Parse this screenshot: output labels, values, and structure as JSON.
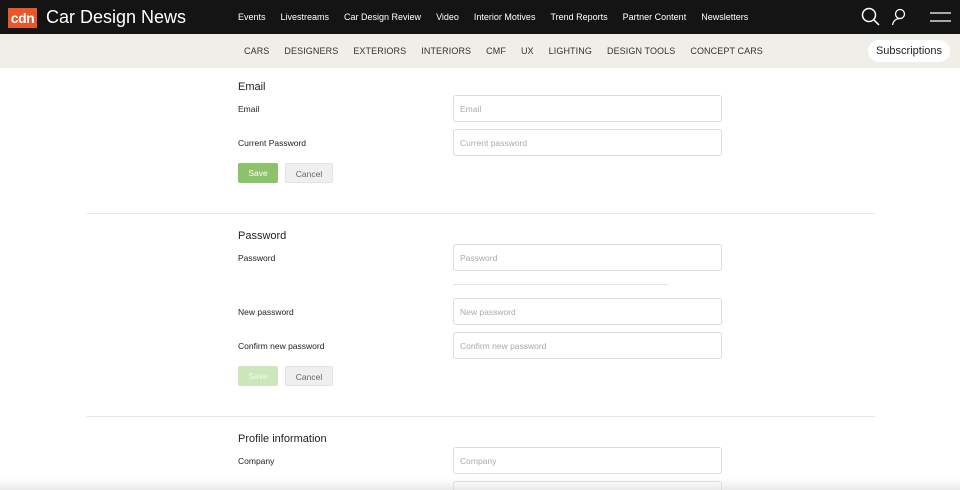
{
  "header": {
    "logo_text": "cdn",
    "brand": "Car Design News",
    "nav": [
      "Events",
      "Livestreams",
      "Car Design Review",
      "Video",
      "Interior Motives",
      "Trend Reports",
      "Partner Content",
      "Newsletters"
    ],
    "icons": [
      "search-icon",
      "user-icon",
      "menu-icon"
    ]
  },
  "subnav": {
    "items": [
      "CARS",
      "DESIGNERS",
      "EXTERIORS",
      "INTERIORS",
      "CMF",
      "UX",
      "LIGHTING",
      "DESIGN TOOLS",
      "CONCEPT CARS"
    ],
    "subscriptions_label": "Subscriptions"
  },
  "email_section": {
    "title": "Email",
    "email_label": "Email",
    "email_placeholder": "Email",
    "current_password_label": "Current Password",
    "current_password_placeholder": "Current password",
    "save_label": "Save",
    "cancel_label": "Cancel"
  },
  "password_section": {
    "title": "Password",
    "password_label": "Password",
    "password_placeholder": "Password",
    "new_password_label": "New password",
    "new_password_placeholder": "New password",
    "confirm_label": "Confirm new password",
    "confirm_placeholder": "Confirm new password",
    "save_label": "Save",
    "cancel_label": "Cancel"
  },
  "profile_section": {
    "title": "Profile information",
    "company_label": "Company",
    "company_placeholder": "Company"
  },
  "colors": {
    "topbar": "#141414",
    "logo": "#e8562a",
    "subbar": "#efeee9",
    "save_button": "#8dc26a"
  }
}
